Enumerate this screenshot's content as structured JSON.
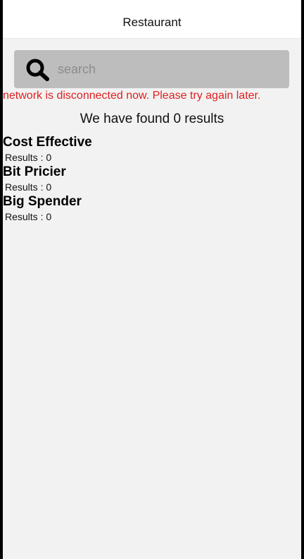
{
  "nav": {
    "title": "Restaurant"
  },
  "search": {
    "placeholder": "search",
    "value": ""
  },
  "status": {
    "error_message": "network is disconnected now. Please try again later.",
    "error_color": "#e02020"
  },
  "results": {
    "summary": "We have found 0 results"
  },
  "categories": [
    {
      "name": "Cost Effective",
      "count_label": "Results : 0"
    },
    {
      "name": "Bit Pricier",
      "count_label": "Results : 0"
    },
    {
      "name": "Big Spender",
      "count_label": "Results : 0"
    }
  ],
  "icons": {
    "search": "search-icon"
  }
}
